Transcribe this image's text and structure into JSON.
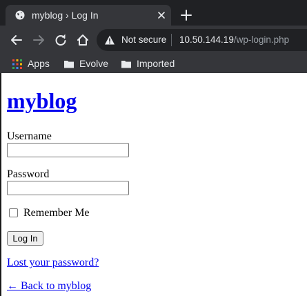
{
  "browser": {
    "tab": {
      "title": "myblog › Log In"
    },
    "omnibox": {
      "security_label": "Not secure",
      "url_host": "10.50.144.19",
      "url_path": "/wp-login.php"
    },
    "bookmarks": [
      {
        "label": "Apps",
        "icon": "apps-grid-icon"
      },
      {
        "label": "Evolve",
        "icon": "folder-icon"
      },
      {
        "label": "Imported",
        "icon": "folder-icon"
      }
    ]
  },
  "page": {
    "site_title": "myblog",
    "username_label": "Username",
    "username_value": "",
    "password_label": "Password",
    "password_value": "",
    "remember_label": "Remember Me",
    "remember_checked": false,
    "login_button": "Log In",
    "lost_password_link": "Lost your password?",
    "back_link": "← Back to myblog",
    "link_color": "#0000ee"
  }
}
